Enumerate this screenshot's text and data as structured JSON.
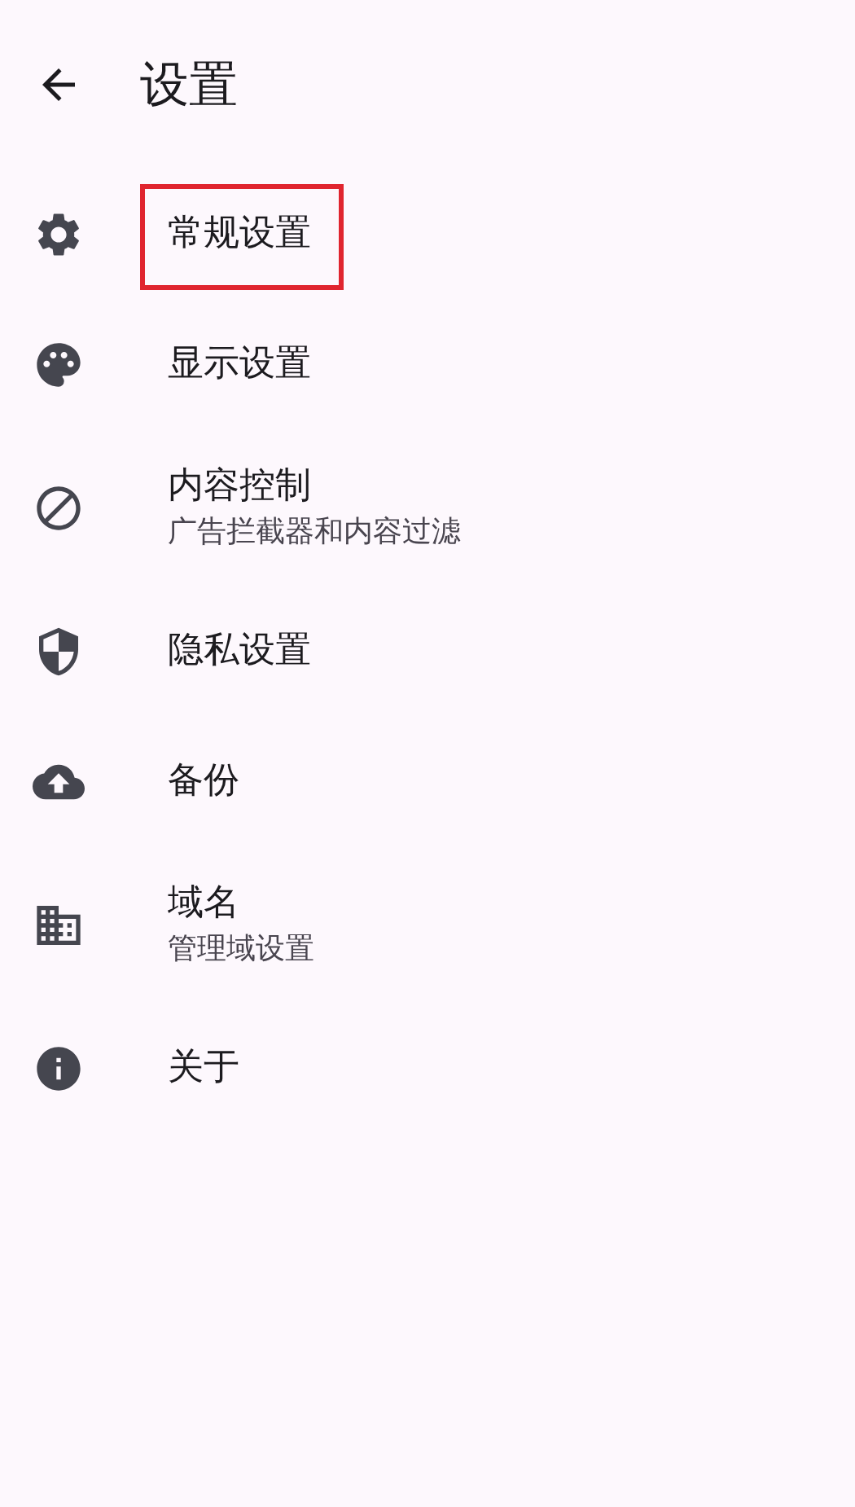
{
  "header": {
    "title": "设置"
  },
  "items": [
    {
      "title": "常规设置",
      "highlighted": true
    },
    {
      "title": "显示设置",
      "highlighted": false
    },
    {
      "title": "内容控制",
      "subtitle": "广告拦截器和内容过滤",
      "highlighted": false
    },
    {
      "title": "隐私设置",
      "highlighted": false
    },
    {
      "title": "备份",
      "highlighted": false
    },
    {
      "title": "域名",
      "subtitle": "管理域设置",
      "highlighted": false
    },
    {
      "title": "关于",
      "highlighted": false
    }
  ]
}
